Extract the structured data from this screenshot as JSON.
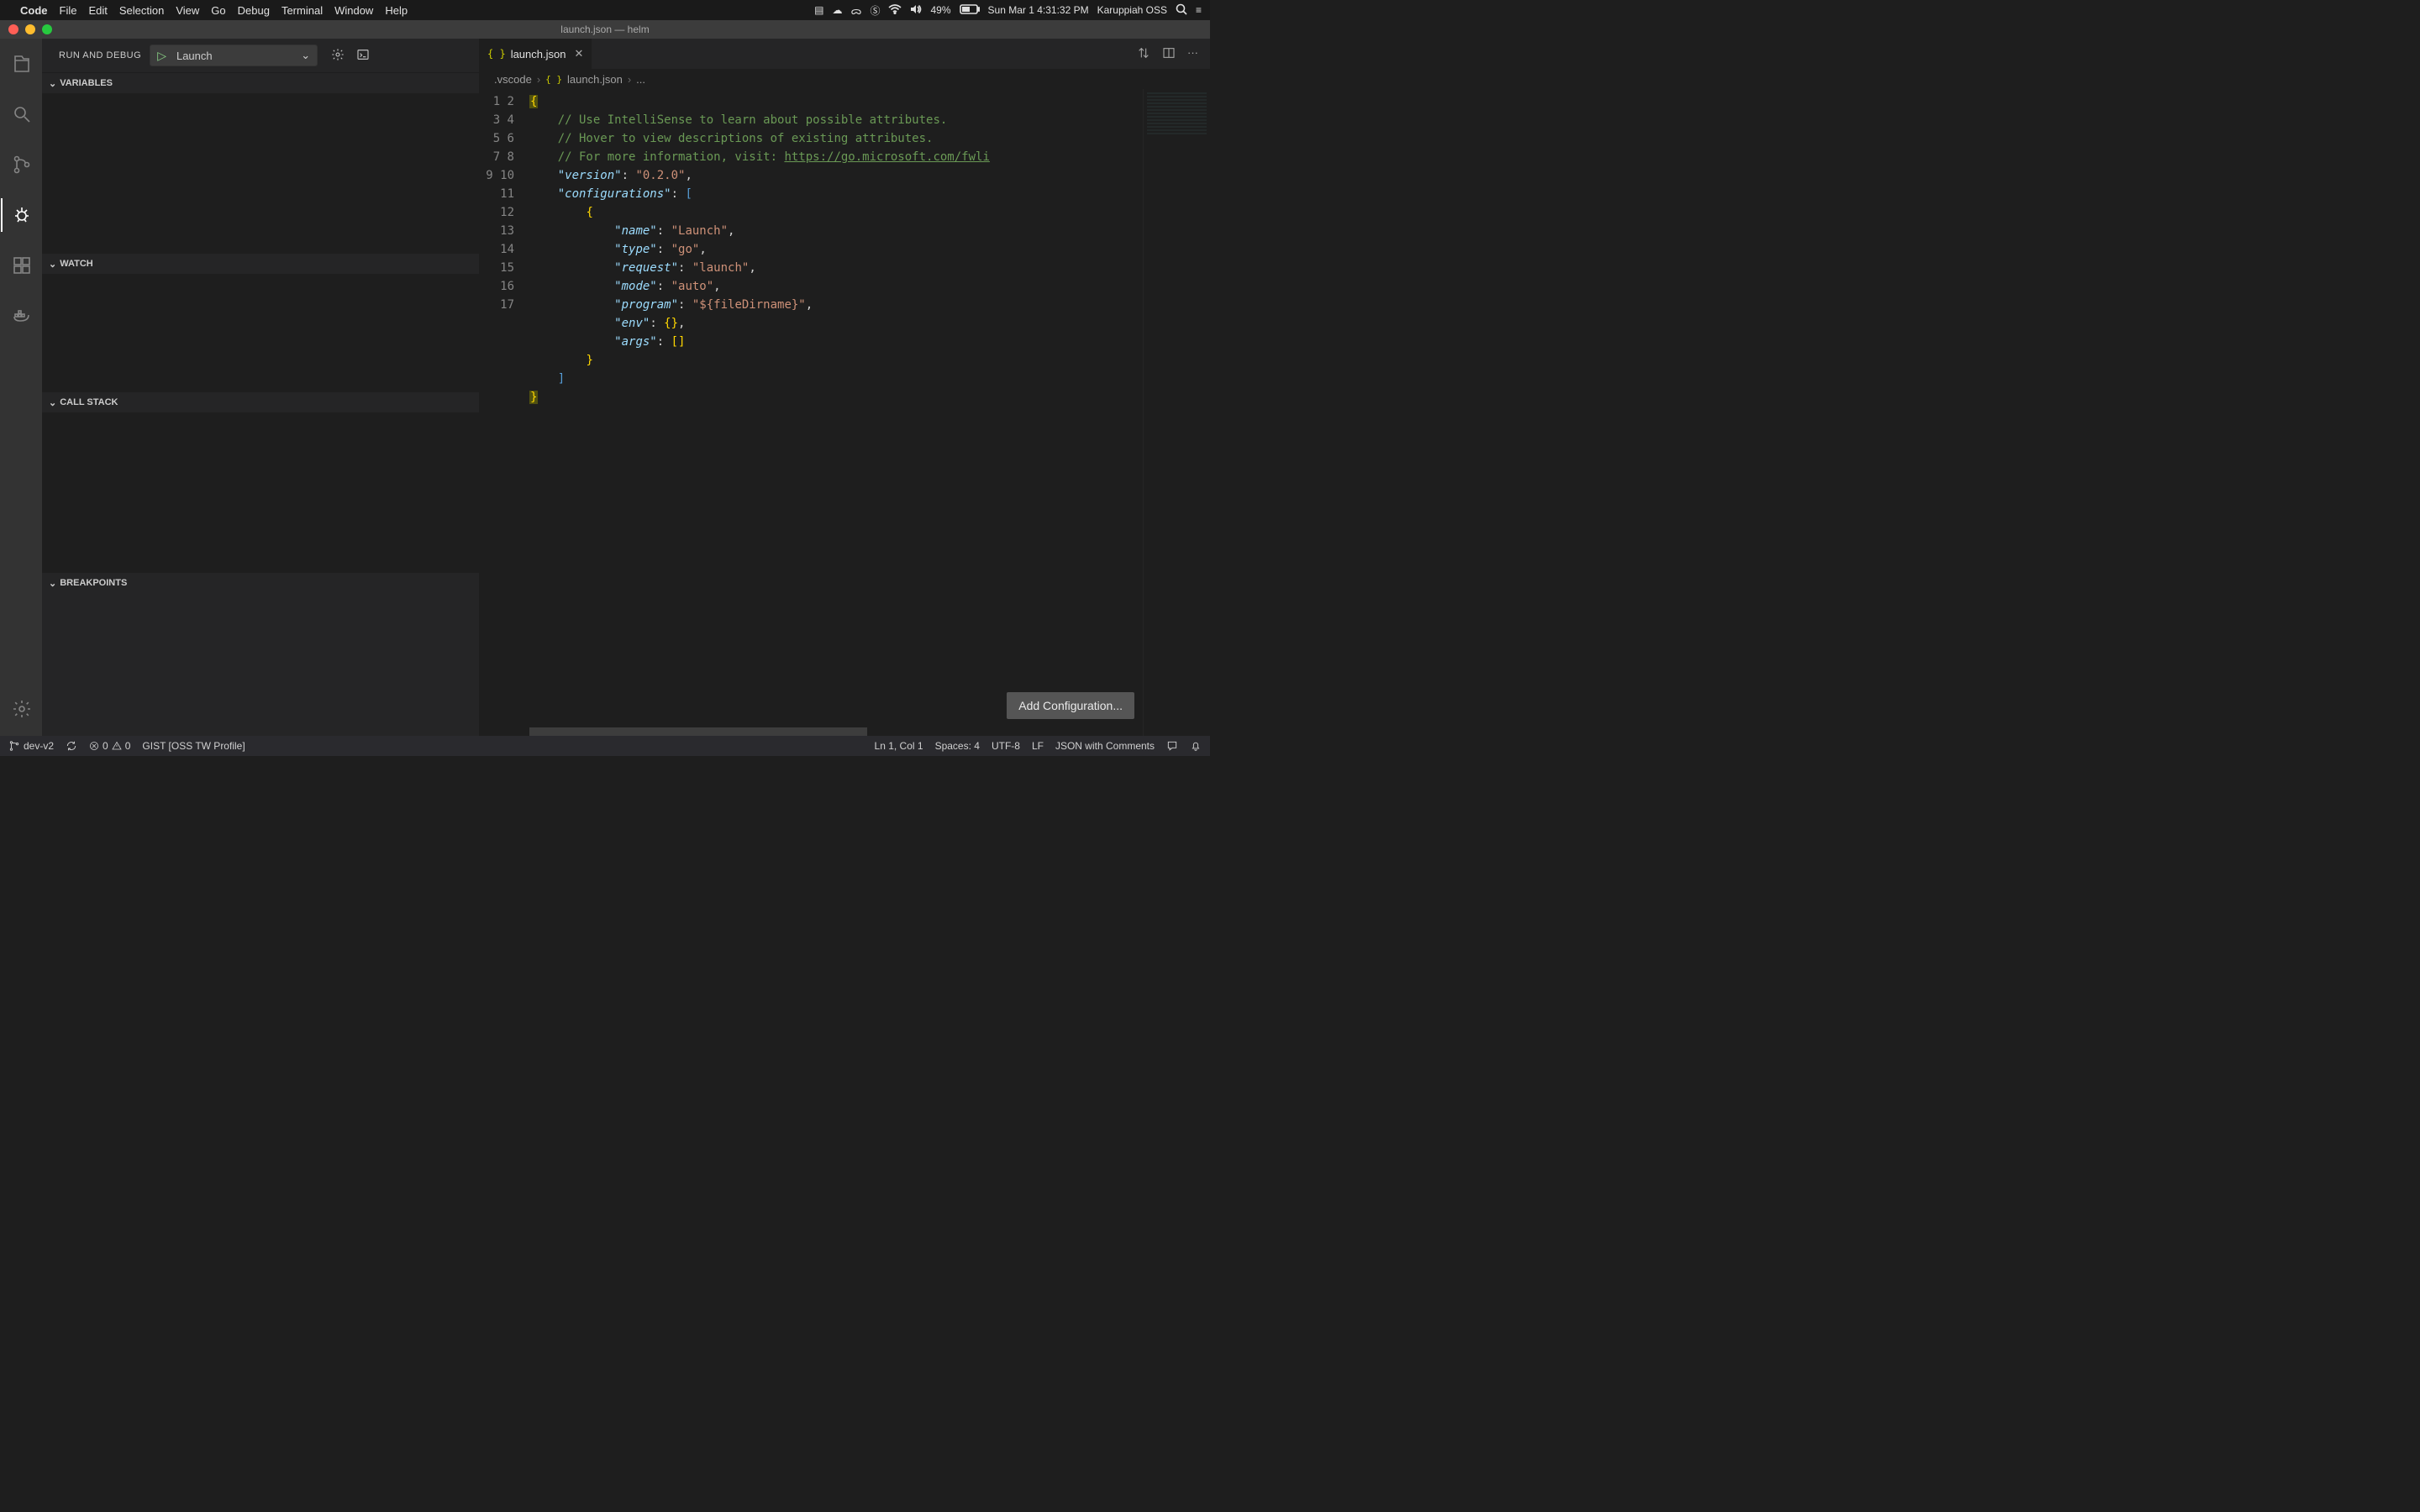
{
  "menubar": {
    "app": "Code",
    "items": [
      "File",
      "Edit",
      "Selection",
      "View",
      "Go",
      "Debug",
      "Terminal",
      "Window",
      "Help"
    ],
    "battery": "49%",
    "datetime": "Sun Mar 1  4:31:32 PM",
    "user": "Karuppiah OSS"
  },
  "titlebar": {
    "title": "launch.json — helm"
  },
  "sidebar": {
    "title": "RUN AND DEBUG",
    "config_name": "Launch",
    "sections": {
      "variables": "VARIABLES",
      "watch": "WATCH",
      "callstack": "CALL STACK",
      "breakpoints": "BREAKPOINTS"
    }
  },
  "tab": {
    "filename": "launch.json"
  },
  "breadcrumbs": {
    "folder": ".vscode",
    "file": "launch.json",
    "trail": "..."
  },
  "code": {
    "line_count": 17,
    "comments": [
      "// Use IntelliSense to learn about possible attributes.",
      "// Hover to view descriptions of existing attributes.",
      "// For more information, visit: "
    ],
    "link": "https://go.microsoft.com/fwli",
    "version_key": "\"version\"",
    "version_val": "\"0.2.0\"",
    "configurations_key": "\"configurations\"",
    "cfg": {
      "name_key": "\"name\"",
      "name_val": "\"Launch\"",
      "type_key": "\"type\"",
      "type_val": "\"go\"",
      "request_key": "\"request\"",
      "request_val": "\"launch\"",
      "mode_key": "\"mode\"",
      "mode_val": "\"auto\"",
      "program_key": "\"program\"",
      "program_val": "\"${fileDirname}\"",
      "env_key": "\"env\"",
      "args_key": "\"args\""
    }
  },
  "add_config_label": "Add Configuration...",
  "statusbar": {
    "branch": "dev-v2",
    "errors": "0",
    "warnings": "0",
    "gist": "GIST [OSS TW Profile]",
    "cursor": "Ln 1, Col 1",
    "spaces": "Spaces: 4",
    "encoding": "UTF-8",
    "eol": "LF",
    "lang": "JSON with Comments"
  }
}
